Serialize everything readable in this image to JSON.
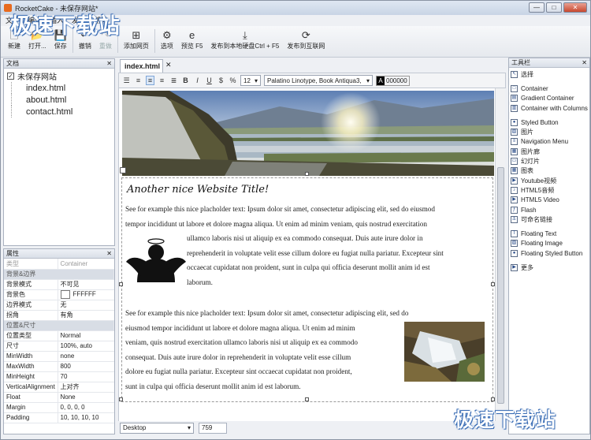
{
  "window": {
    "title": "RocketCake - 未保存网站*",
    "controls": [
      "—",
      "□",
      "✕"
    ]
  },
  "menu": [
    "文件",
    "编辑",
    "插入",
    "发布",
    "帮助"
  ],
  "toolbar": [
    {
      "label": "新建",
      "icon": "new-icon",
      "glyph": "🗋",
      "enabled": true
    },
    {
      "label": "打开...",
      "icon": "open-icon",
      "glyph": "📂",
      "enabled": true
    },
    {
      "label": "保存",
      "icon": "save-icon",
      "glyph": "💾",
      "enabled": true
    },
    {
      "label": "撤销",
      "icon": "undo-icon",
      "glyph": "↶",
      "enabled": true
    },
    {
      "label": "重做",
      "icon": "redo-icon",
      "glyph": "↷",
      "enabled": false
    },
    {
      "label": "添加网页",
      "icon": "add-page-icon",
      "glyph": "⊞",
      "enabled": true
    },
    {
      "label": "选项",
      "icon": "gear-icon",
      "glyph": "⚙",
      "enabled": true
    },
    {
      "label": "预览 F5",
      "icon": "preview-icon",
      "glyph": "e",
      "enabled": true
    },
    {
      "label": "发布到本地硬盘Ctrl + F5",
      "icon": "publish-disk-icon",
      "glyph": "⤓",
      "enabled": true
    },
    {
      "label": "发布到互联网",
      "icon": "publish-web-icon",
      "glyph": "⟳",
      "enabled": true
    }
  ],
  "documents": {
    "header": "文档",
    "root": "未保存网站",
    "files": [
      "index.html",
      "about.html",
      "contact.html"
    ]
  },
  "properties": {
    "header": "属性",
    "rows": [
      {
        "key": "类型",
        "value": "Container",
        "kind": "dim"
      },
      {
        "key": "背景&边界",
        "value": "",
        "kind": "section"
      },
      {
        "key": "背景模式",
        "value": "不可见",
        "kind": "row"
      },
      {
        "key": "背景色",
        "value": "FFFFFF",
        "kind": "color"
      },
      {
        "key": "边界模式",
        "value": "无",
        "kind": "row"
      },
      {
        "key": "拐角",
        "value": "有角",
        "kind": "row"
      },
      {
        "key": "位置&尺寸",
        "value": "",
        "kind": "section"
      },
      {
        "key": "位置类型",
        "value": "Normal",
        "kind": "row"
      },
      {
        "key": "尺寸",
        "value": "100%, auto",
        "kind": "row"
      },
      {
        "key": "MinWidth",
        "value": "none",
        "kind": "row"
      },
      {
        "key": "MaxWidth",
        "value": "800",
        "kind": "row"
      },
      {
        "key": "MinHeight",
        "value": "70",
        "kind": "row"
      },
      {
        "key": "VerticalAlignment",
        "value": "上对齐",
        "kind": "row"
      },
      {
        "key": "Float",
        "value": "None",
        "kind": "row"
      },
      {
        "key": "Margin",
        "value": "0, 0, 0, 0",
        "kind": "row"
      },
      {
        "key": "Padding",
        "value": "10, 10, 10, 10",
        "kind": "row"
      }
    ]
  },
  "editor": {
    "tab": "index.html",
    "font_size": "12",
    "font_family": "Palatino Linotype, Book Antiqua3,",
    "color_label": "A",
    "color_value": "000000",
    "page_title": "Another nice Website Title!",
    "para1_lines": [
      "See for example this nice placholder text: Ipsum dolor sit amet, consectetur adipiscing elit, sed do eiusmod",
      "tempor incididunt ut labore et dolore magna aliqua. Ut enim ad minim veniam, quis nostrud exercitation"
    ],
    "para1_wrap": [
      "ullamco laboris nisi ut aliquip ex ea commodo consequat. Duis aute irure dolor in",
      "reprehenderit in voluptate velit esse cillum dolore eu fugiat nulla pariatur. Excepteur sint",
      "occaecat cupidatat non proident, sunt in culpa qui officia deserunt mollit anim id est",
      "laborum."
    ],
    "para2_lines": [
      "See for example this nice placholder text: Ipsum dolor sit amet, consectetur adipiscing elit, sed do",
      "eiusmod tempor incididunt ut labore et dolore magna aliqua. Ut enim ad minim",
      "veniam, quis nostrud exercitation ullamco laboris nisi ut aliquip ex ea commodo",
      "consequat. Duis aute irure dolor in reprehenderit in voluptate velit esse cillum",
      "dolore eu fugiat nulla pariatur. Excepteur sint occaecat cupidatat non proident,",
      "sunt in culpa qui officia deserunt mollit anim id est laborum."
    ]
  },
  "status": {
    "view": "Desktop",
    "width": "759"
  },
  "tools": {
    "header": "工具栏",
    "items": [
      {
        "label": "选择",
        "icon": "select-icon",
        "glyph": "↖"
      },
      {
        "label": "Container",
        "icon": "container-icon",
        "glyph": "□"
      },
      {
        "label": "Gradient Container",
        "icon": "gradient-container-icon",
        "glyph": "▤"
      },
      {
        "label": "Container with Columns",
        "icon": "columns-container-icon",
        "glyph": "▥"
      },
      {
        "label": "Styled Button",
        "icon": "button-icon",
        "glyph": "●"
      },
      {
        "label": "图片",
        "icon": "image-icon",
        "glyph": "▨"
      },
      {
        "label": "Navigation Menu",
        "icon": "menu-icon",
        "glyph": "≡"
      },
      {
        "label": "图片廊",
        "icon": "gallery-icon",
        "glyph": "▦"
      },
      {
        "label": "幻灯片",
        "icon": "slideshow-icon",
        "glyph": "▭"
      },
      {
        "label": "图表",
        "icon": "chart-icon",
        "glyph": "▦"
      },
      {
        "label": "Youtube视频",
        "icon": "youtube-icon",
        "glyph": "▶"
      },
      {
        "label": "HTML5音频",
        "icon": "audio-icon",
        "glyph": "♪"
      },
      {
        "label": "HTML5 Video",
        "icon": "video-icon",
        "glyph": "▶"
      },
      {
        "label": "Flash",
        "icon": "flash-icon",
        "glyph": "ƒ"
      },
      {
        "label": "可命名链接",
        "icon": "anchor-icon",
        "glyph": "⚓"
      },
      {
        "label": "Floating Text",
        "icon": "floating-text-icon",
        "glyph": "T"
      },
      {
        "label": "Floating Image",
        "icon": "floating-image-icon",
        "glyph": "▨"
      },
      {
        "label": "Floating Styled Button",
        "icon": "floating-button-icon",
        "glyph": "●"
      },
      {
        "label": "更多",
        "icon": "more-icon",
        "glyph": "▶"
      }
    ]
  },
  "watermark": "极速下载站"
}
